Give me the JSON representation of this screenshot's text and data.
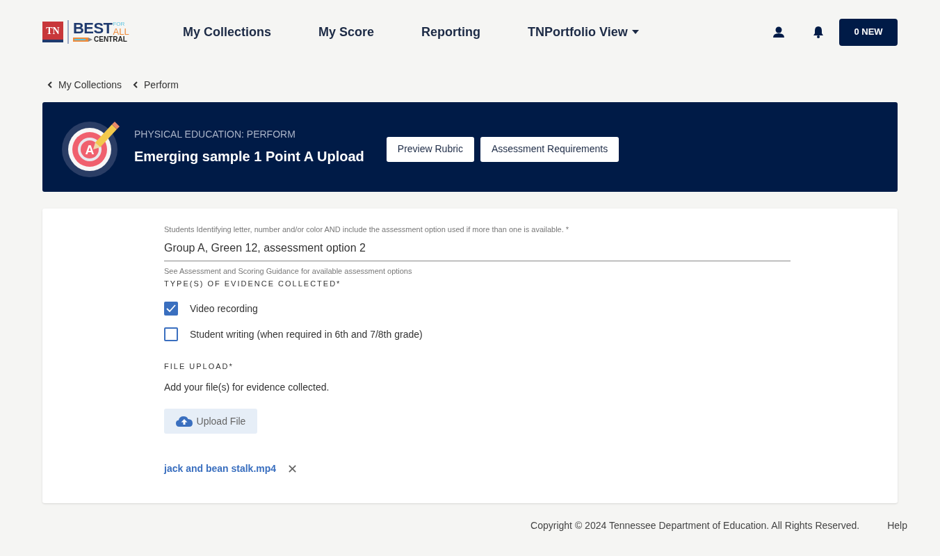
{
  "logo": {
    "badge": "TN",
    "word": "BEST",
    "for": "FOR",
    "all": "ALL",
    "sub": "CENTRAL"
  },
  "nav": [
    {
      "label": "My Collections",
      "dropdown": false
    },
    {
      "label": "My Score",
      "dropdown": false
    },
    {
      "label": "Reporting",
      "dropdown": false
    },
    {
      "label": "TNPortfolio View",
      "dropdown": true
    }
  ],
  "notifications_button": "0 NEW",
  "breadcrumbs": [
    "My Collections",
    "Perform"
  ],
  "header": {
    "category": "PHYSICAL EDUCATION: PERFORM",
    "title": "Emerging sample 1 Point A Upload",
    "icon_letter": "A",
    "buttons": [
      "Preview Rubric",
      "Assessment Requirements"
    ]
  },
  "form": {
    "student_field": {
      "label": "Students Identifying letter, number and/or color AND include the assessment option used if more than one is available. *",
      "value": "Group A, Green 12, assessment option 2",
      "hint": "See Assessment and Scoring Guidance for available assessment options"
    },
    "evidence_heading": "TYPE(S) OF EVIDENCE COLLECTED*",
    "evidence_options": [
      {
        "label": "Video recording",
        "checked": true
      },
      {
        "label": "Student writing (when required in 6th and 7/8th grade)",
        "checked": false
      }
    ],
    "upload_heading": "FILE UPLOAD*",
    "upload_text": "Add your file(s) for evidence collected.",
    "upload_button": "Upload File",
    "files": [
      {
        "name": "jack and bean stalk.mp4",
        "remove": "✕"
      }
    ]
  },
  "footer": {
    "copyright": "Copyright © 2024 Tennessee Department of Education. All Rights Reserved.",
    "help": "Help"
  }
}
